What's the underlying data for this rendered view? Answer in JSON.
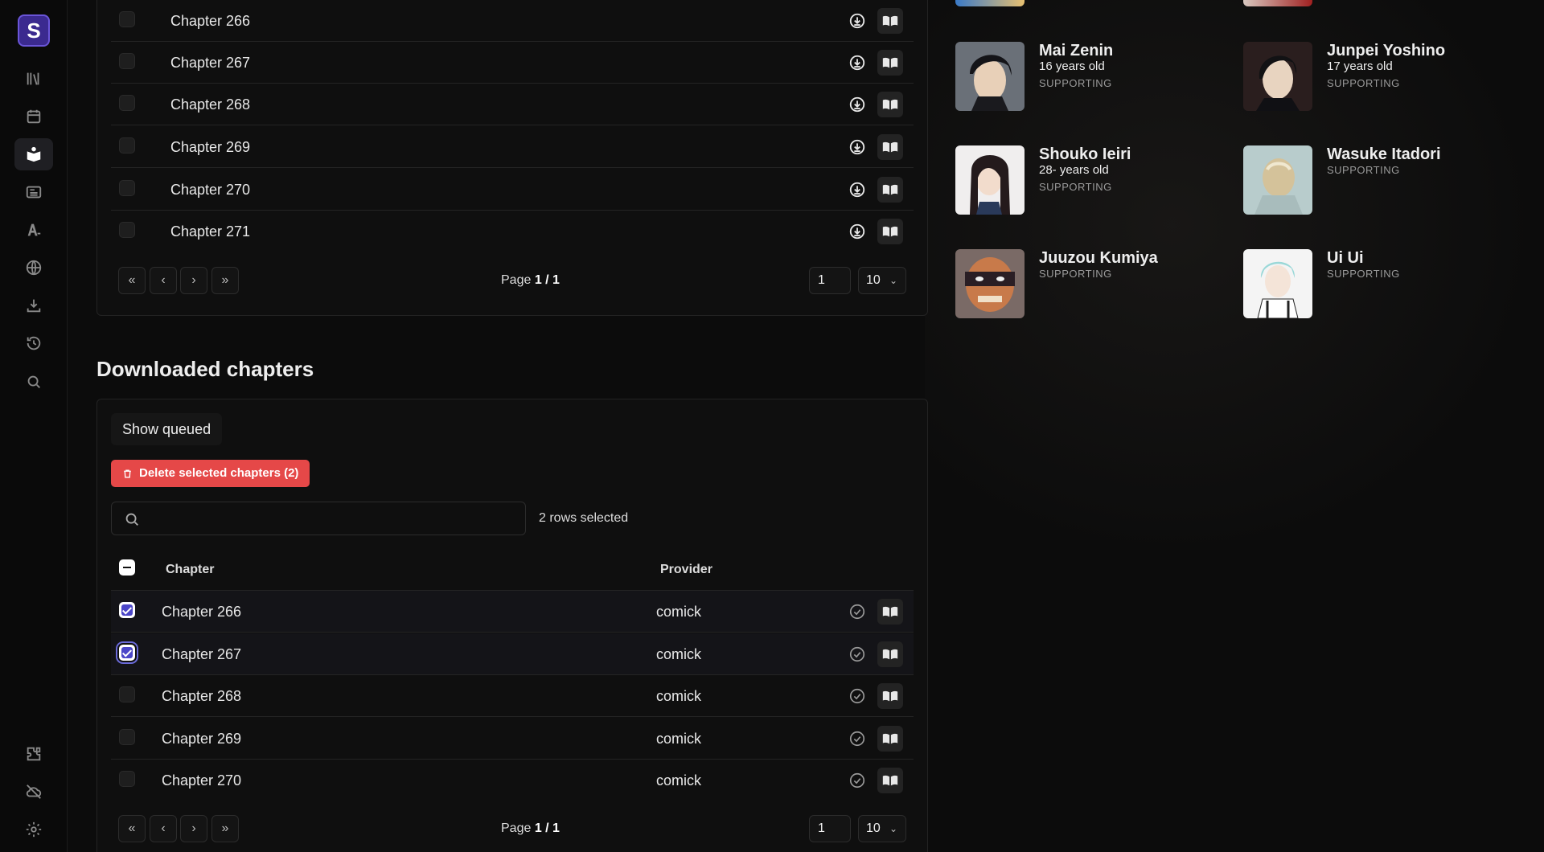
{
  "app": {
    "logo_letter": "S"
  },
  "sidebar": {
    "items": [
      {
        "name": "library-icon"
      },
      {
        "name": "calendar-icon"
      },
      {
        "name": "manga-icon",
        "active": true
      },
      {
        "name": "news-icon"
      },
      {
        "name": "anilist-icon"
      },
      {
        "name": "globe-icon"
      },
      {
        "name": "download-icon"
      },
      {
        "name": "history-icon"
      },
      {
        "name": "search-icon"
      }
    ],
    "bottom_items": [
      {
        "name": "extensions-icon"
      },
      {
        "name": "cloud-off-icon"
      },
      {
        "name": "settings-icon"
      }
    ]
  },
  "chapters_table": {
    "rows": [
      {
        "chapter": "Chapter 266"
      },
      {
        "chapter": "Chapter 267"
      },
      {
        "chapter": "Chapter 268"
      },
      {
        "chapter": "Chapter 269"
      },
      {
        "chapter": "Chapter 270"
      },
      {
        "chapter": "Chapter 271"
      }
    ],
    "pagination": {
      "page_prefix": "Page ",
      "page_value": "1 / 1",
      "page_input": "1",
      "page_size": "10"
    }
  },
  "downloaded": {
    "title": "Downloaded chapters",
    "show_queued_label": "Show queued",
    "delete_label": "Delete selected chapters (2)",
    "search_placeholder": "",
    "rows_selected": "2 rows selected",
    "headers": {
      "chapter": "Chapter",
      "provider": "Provider"
    },
    "rows": [
      {
        "chapter": "Chapter 266",
        "provider": "comick",
        "checked": true
      },
      {
        "chapter": "Chapter 267",
        "provider": "comick",
        "checked": true
      },
      {
        "chapter": "Chapter 268",
        "provider": "comick",
        "checked": false
      },
      {
        "chapter": "Chapter 269",
        "provider": "comick",
        "checked": false
      },
      {
        "chapter": "Chapter 270",
        "provider": "comick",
        "checked": false
      }
    ],
    "pagination": {
      "page_prefix": "Page ",
      "page_value": "1 / 1",
      "page_input": "1",
      "page_size": "10"
    }
  },
  "characters": [
    {
      "name": "Mai Zenin",
      "age": "16 years old",
      "role": "SUPPORTING"
    },
    {
      "name": "Junpei Yoshino",
      "age": "17 years old",
      "role": "SUPPORTING"
    },
    {
      "name": "Shouko Ieiri",
      "age": "28- years old",
      "role": "SUPPORTING"
    },
    {
      "name": "Wasuke Itadori",
      "age": "",
      "role": "SUPPORTING"
    },
    {
      "name": "Juuzou Kumiya",
      "age": "",
      "role": "SUPPORTING"
    },
    {
      "name": "Ui Ui",
      "age": "",
      "role": "SUPPORTING"
    }
  ],
  "colors": {
    "accent": "#4b46c8",
    "danger": "#e54848",
    "background": "#0c0c0c"
  }
}
